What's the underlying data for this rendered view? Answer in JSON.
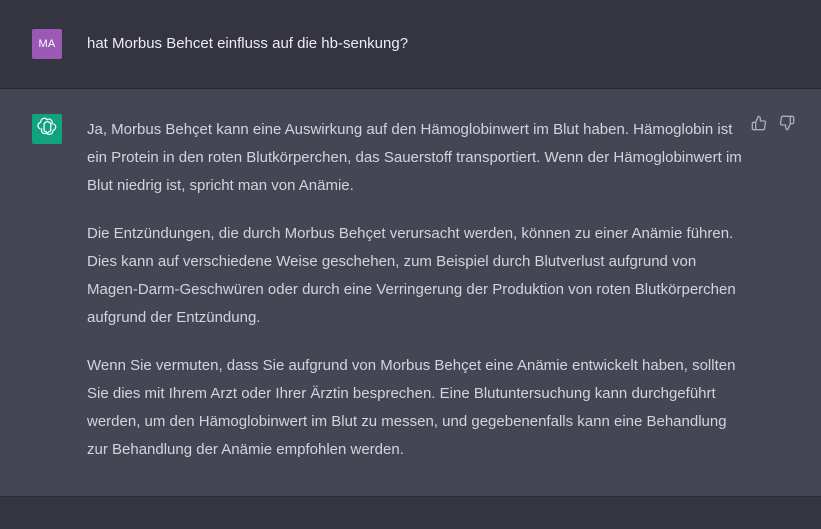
{
  "user_message": {
    "avatar_initials": "MA",
    "avatar_color": "#9b59b6",
    "text": "hat Morbus Behcet einfluss auf die hb-senkung?"
  },
  "assistant_message": {
    "avatar_icon": "openai-logo-icon",
    "avatar_color": "#10a37f",
    "paragraphs": [
      "Ja, Morbus Behçet kann eine Auswirkung auf den Hämoglobinwert im Blut haben. Hämoglobin ist ein Protein in den roten Blutkörperchen, das Sauerstoff transportiert. Wenn der Hämoglobinwert im Blut niedrig ist, spricht man von Anämie.",
      "Die Entzündungen, die durch Morbus Behçet verursacht werden, können zu einer Anämie führen. Dies kann auf verschiedene Weise geschehen, zum Beispiel durch Blutverlust aufgrund von Magen-Darm-Geschwüren oder durch eine Verringerung der Produktion von roten Blutkörperchen aufgrund der Entzündung.",
      "Wenn Sie vermuten, dass Sie aufgrund von Morbus Behçet eine Anämie entwickelt haben, sollten Sie dies mit Ihrem Arzt oder Ihrer Ärztin besprechen. Eine Blutuntersuchung kann durchgeführt werden, um den Hämoglobinwert im Blut zu messen, und gegebenenfalls kann eine Behandlung zur Behandlung der Anämie empfohlen werden."
    ],
    "feedback_icons": [
      "thumbs-up-icon",
      "thumbs-down-icon"
    ]
  },
  "colors": {
    "page_background": "#343541",
    "assistant_background": "#444654",
    "text_user": "#ececf1",
    "text_assistant": "#d1d5db",
    "icon_muted": "#acacbe"
  }
}
